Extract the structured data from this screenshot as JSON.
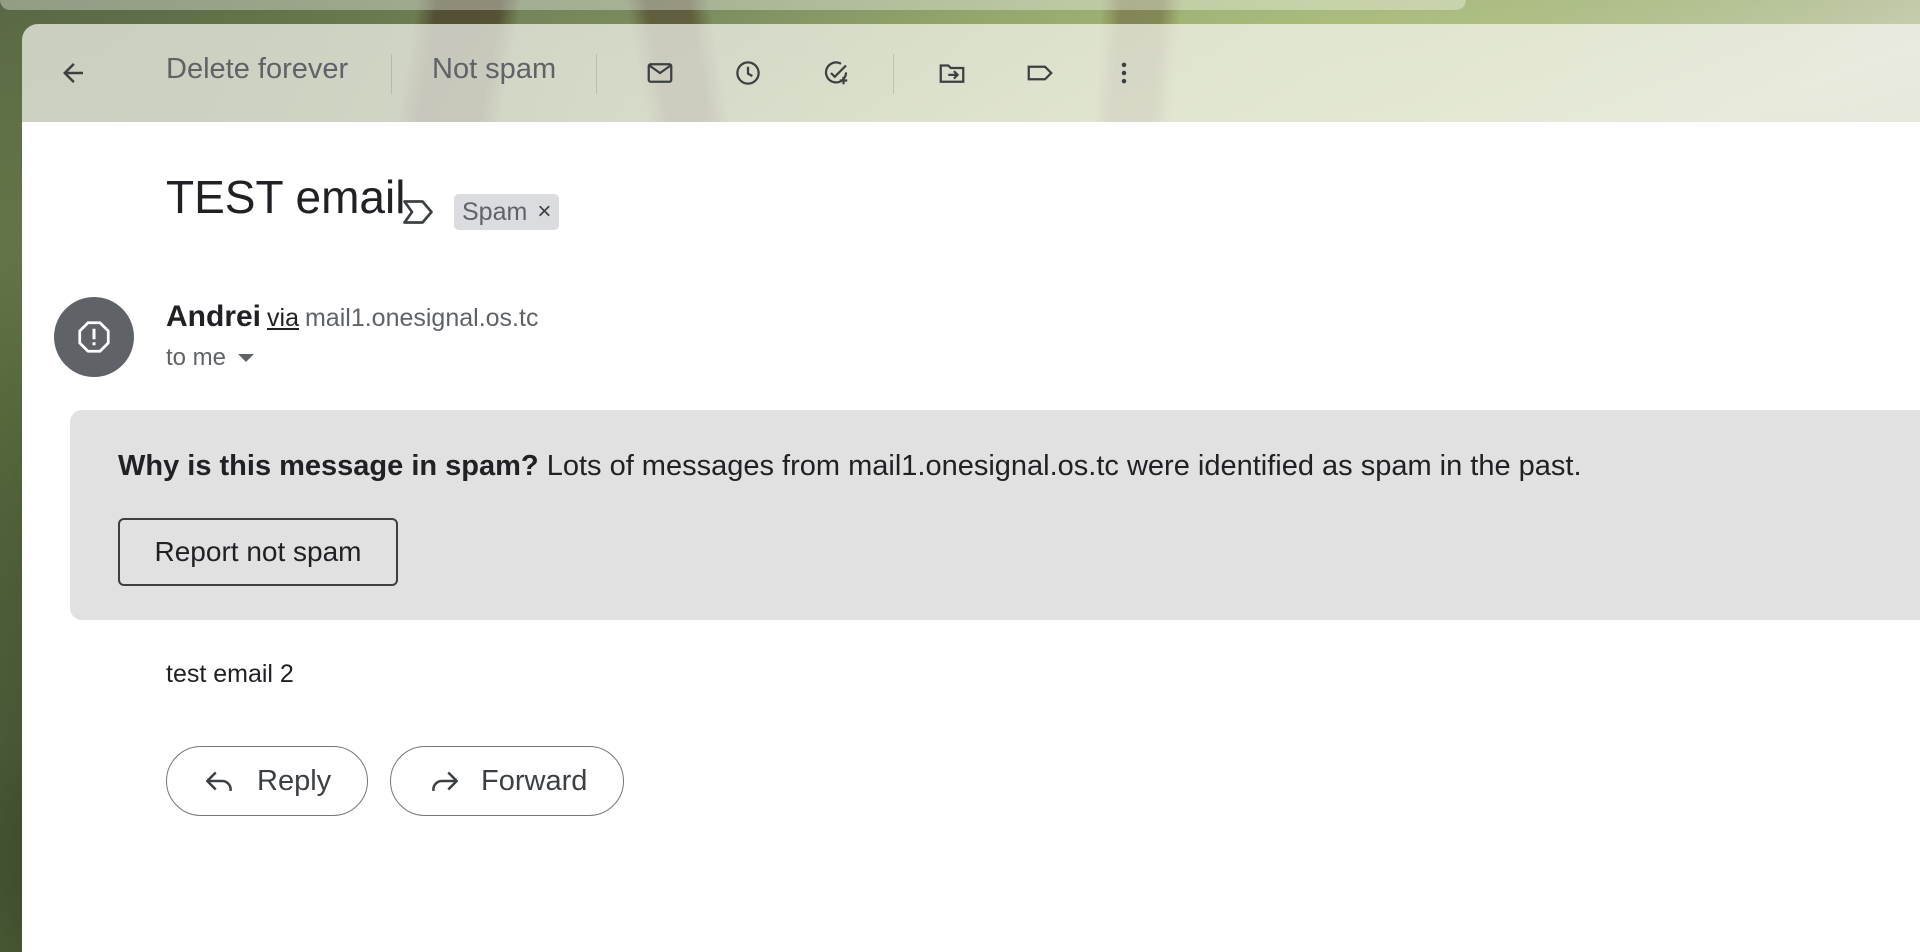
{
  "toolbar": {
    "back_icon": "arrow-back-icon",
    "delete_forever_label": "Delete forever",
    "not_spam_label": "Not spam",
    "icons": [
      "mark-unread-icon",
      "snooze-icon",
      "add-task-icon",
      "move-to-icon",
      "label-icon",
      "more-vert-icon"
    ]
  },
  "message": {
    "subject": "TEST email",
    "label_chip": "Spam",
    "label_chip_remove": "×",
    "sender_name": "Andrei",
    "via_label": "via",
    "via_domain": "mail1.onesignal.os.tc",
    "to_label": "to me",
    "body": "test email 2"
  },
  "spam_notice": {
    "question": "Why is this message in spam?",
    "reason": " Lots of messages from mail1.onesignal.os.tc were identified as spam in the past.",
    "button_label": "Report not spam"
  },
  "actions": {
    "reply_label": "Reply",
    "forward_label": "Forward"
  },
  "colors": {
    "avatar": "#5f6368",
    "notice_bg": "#e1e1e1",
    "chip_bg": "#dadce0"
  }
}
